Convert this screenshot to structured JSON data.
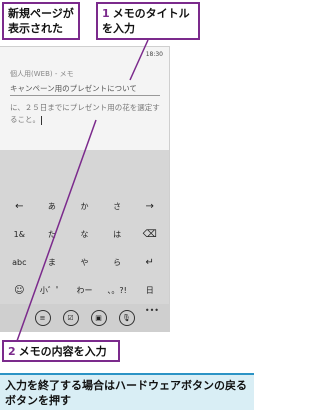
{
  "callouts": {
    "new_page": "新規ページが表示された",
    "title_num": "1",
    "title_text": "メモのタイトルを入力",
    "body_num": "2",
    "body_text": "メモの内容を入力"
  },
  "note": "入力を終了する場合はハードウェアボタンの戻るボタンを押す",
  "phone": {
    "status_time": "18:30",
    "app_title": "個人用(WEB) - メモ",
    "title_value": "キャンペーン用のプレゼントについて",
    "body_value": "に、２５日までにプレゼント用の花を選定すること。"
  },
  "keyboard": {
    "keys": [
      "←",
      "あ",
      "か",
      "さ",
      "→",
      "1&",
      "た",
      "な",
      "は",
      "⌫",
      "abc",
      "ま",
      "や",
      "ら",
      "↵",
      "☺",
      "小゛゜",
      "わー",
      "、。?!",
      "日"
    ]
  },
  "appbar": {
    "icons": [
      "≡",
      "☑",
      "▣",
      "🎙"
    ],
    "more": "•••"
  }
}
